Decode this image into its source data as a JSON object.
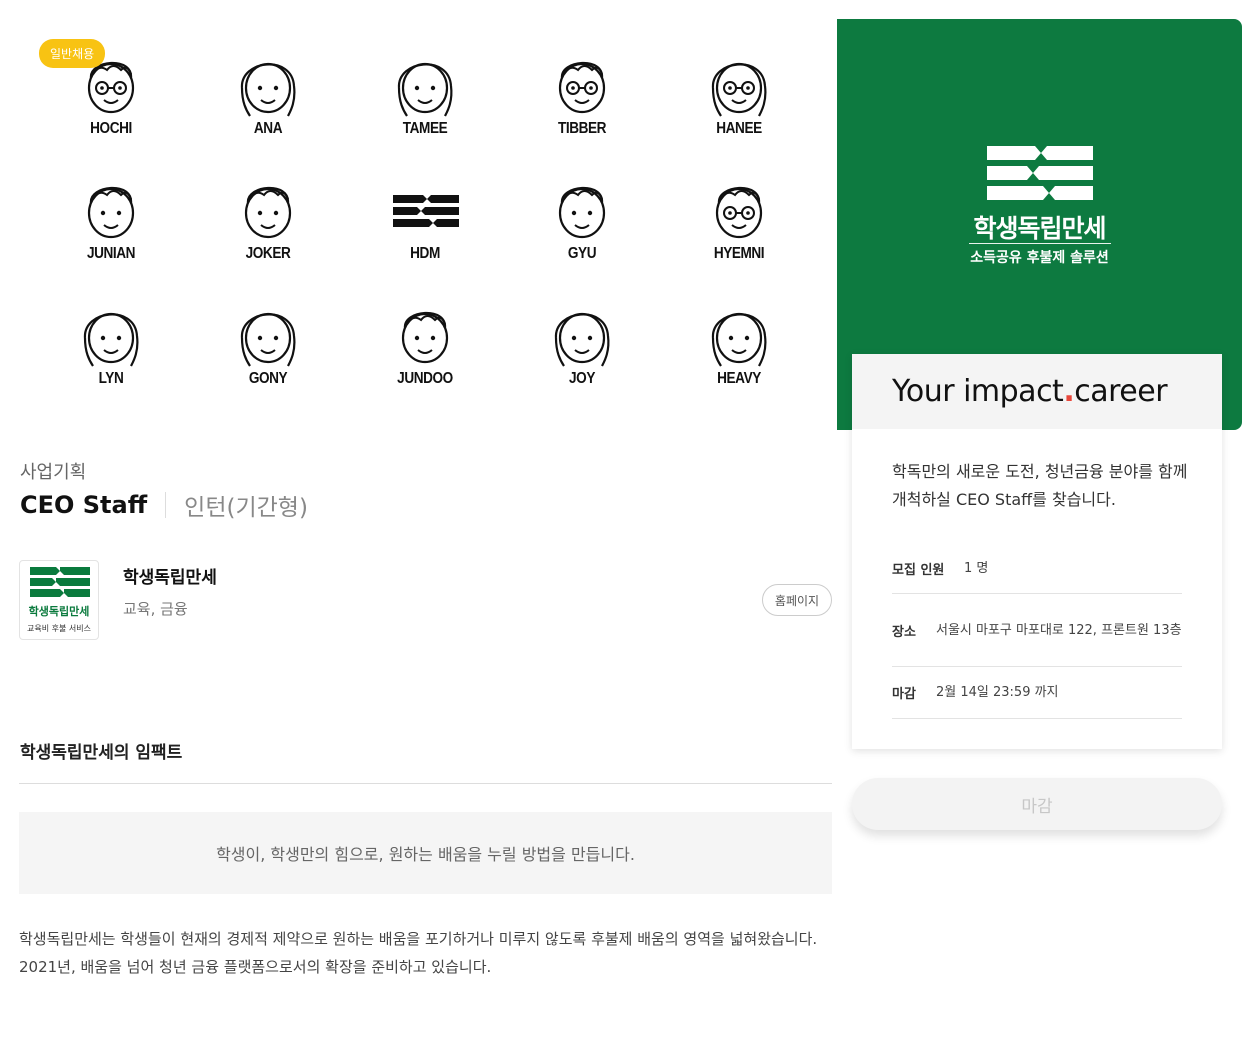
{
  "team": {
    "badge": "일반채용",
    "members": [
      {
        "name": "HOCHI",
        "icon": "hochi-face-icon"
      },
      {
        "name": "ANA",
        "icon": "ana-face-icon"
      },
      {
        "name": "TAMEE",
        "icon": "tamee-face-icon"
      },
      {
        "name": "TIBBER",
        "icon": "tibber-face-icon"
      },
      {
        "name": "HANEE",
        "icon": "hanee-face-icon"
      },
      {
        "name": "JUNIAN",
        "icon": "junian-face-icon"
      },
      {
        "name": "JOKER",
        "icon": "joker-face-icon"
      },
      {
        "name": "HDM",
        "icon": "hdm-logo-icon"
      },
      {
        "name": "GYU",
        "icon": "gyu-face-icon"
      },
      {
        "name": "HYEMNI",
        "icon": "hyemni-face-icon"
      },
      {
        "name": "LYN",
        "icon": "lyn-face-icon"
      },
      {
        "name": "GONY",
        "icon": "gony-face-icon"
      },
      {
        "name": "JUNDOO",
        "icon": "jundoo-face-icon"
      },
      {
        "name": "JOY",
        "icon": "joy-face-icon"
      },
      {
        "name": "HEAVY",
        "icon": "heavy-face-icon"
      }
    ]
  },
  "job": {
    "category": "사업기획",
    "title": "CEO Staff",
    "type": "인턴(기간형)"
  },
  "company": {
    "logo_text": "학생독립만세",
    "logo_sub": "교육비 후불 서비스",
    "name": "학생독립만세",
    "industry": "교육, 금융",
    "homepage_label": "홈페이지"
  },
  "impact": {
    "heading": "학생독립만세의 임팩트",
    "quote": "학생이, 학생만의 힘으로, 원하는 배움을 누릴 방법을 만듭니다.",
    "description": "학생독립만세는 학생들이 현재의 경제적 제약으로 원하는 배움을 포기하거나 미루지 않도록 후불제 배움의 영역을 넓혀왔습니다. 2021년, 배움을 넘어 청년 금융 플랫폼으로서의 확장을 준비하고 있습니다."
  },
  "sidebar": {
    "brand_title": "학생독립만세",
    "brand_subtitle": "소득공유 후불제 솔루션",
    "brand_color": "#0d7a40",
    "tagline_a": "Your impact",
    "tagline_dot": ".",
    "tagline_b": "career",
    "intro": "학독만의 새로운 도전, 청년금융 분야를 함께 개척하실 CEO Staff를 찾습니다.",
    "recruit_label": "모집 인원",
    "recruit_value": "1 명",
    "location_label": "장소",
    "location_value": "서울시 마포구 마포대로 122, 프론트원 13층",
    "deadline_label": "마감",
    "deadline_value": "2월 14일 23:59 까지",
    "deadline_button": "마감"
  },
  "colors": {
    "brand_green": "#0d7a40",
    "badge_yellow": "#f8c313",
    "accent_dot": "#e8473b"
  }
}
